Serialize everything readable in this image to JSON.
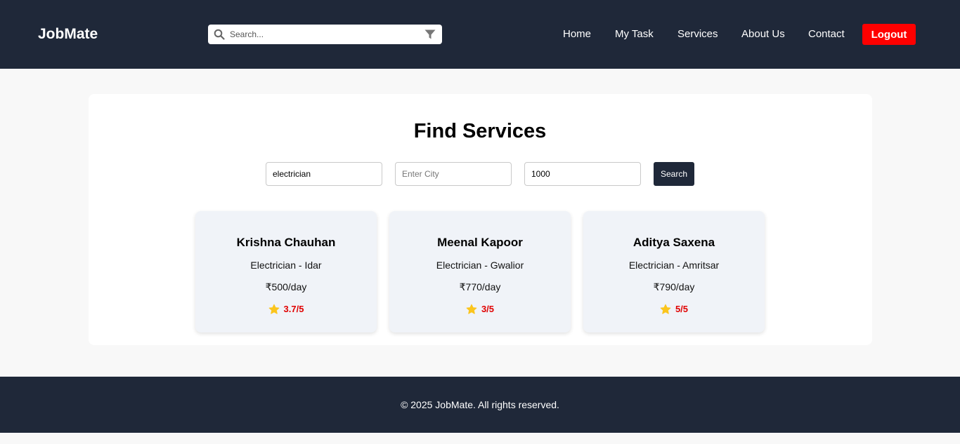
{
  "header": {
    "brand": "JobMate",
    "search_placeholder": "Search...",
    "nav": [
      "Home",
      "My Task",
      "Services",
      "About Us",
      "Contact"
    ],
    "logout_label": "Logout"
  },
  "main": {
    "title": "Find Services",
    "filters": {
      "service_value": "electrician",
      "city_placeholder": "Enter City",
      "budget_value": "1000",
      "search_label": "Search"
    },
    "providers": [
      {
        "name": "Krishna Chauhan",
        "role": "Electrician - Idar",
        "rate": "₹500/day",
        "rating": "3.7/5"
      },
      {
        "name": "Meenal Kapoor",
        "role": "Electrician - Gwalior",
        "rate": "₹770/day",
        "rating": "3/5"
      },
      {
        "name": "Aditya Saxena",
        "role": "Electrician - Amritsar",
        "rate": "₹790/day",
        "rating": "5/5"
      }
    ]
  },
  "footer": {
    "copyright": "© 2025 JobMate. All rights reserved."
  },
  "colors": {
    "navy": "#1f2839",
    "logout": "#ff0000",
    "rating": "#e00000",
    "star": "#fbc51d",
    "card_bg": "#f0f3f8"
  }
}
